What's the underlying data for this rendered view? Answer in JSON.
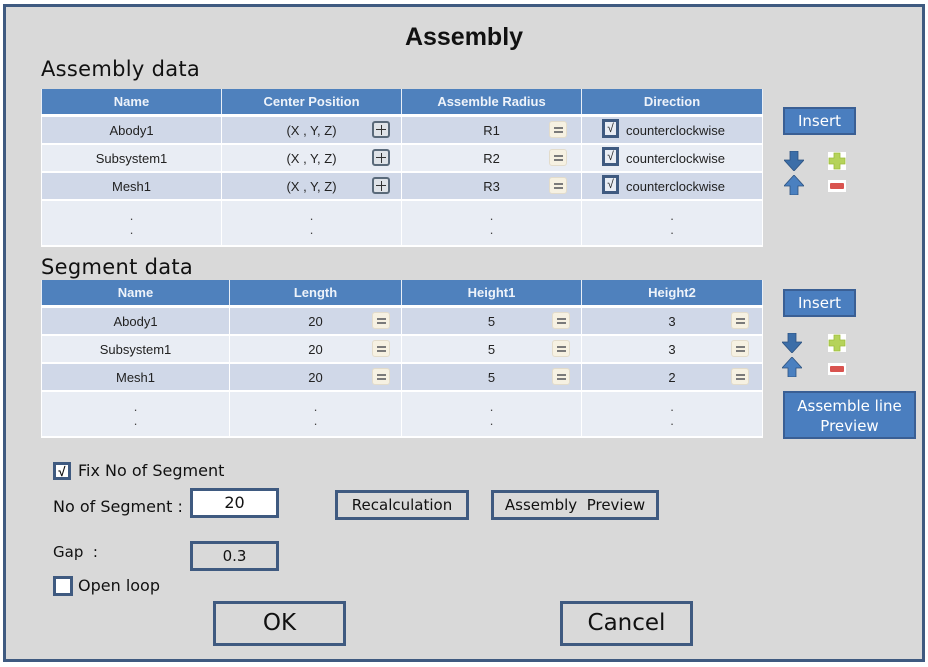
{
  "window": {
    "title": "Assembly"
  },
  "assembly": {
    "section_title": "Assembly data",
    "columns": [
      "Name",
      "Center Position",
      "Assemble Radius",
      "Direction"
    ],
    "rows": [
      {
        "name": "Abody1",
        "center": "(X , Y, Z)",
        "radius": "R1",
        "direction_checked": "√",
        "direction": "counterclockwise"
      },
      {
        "name": "Subsystem1",
        "center": "(X , Y, Z)",
        "radius": "R2",
        "direction_checked": "√",
        "direction": "counterclockwise"
      },
      {
        "name": "Mesh1",
        "center": "(X , Y, Z)",
        "radius": "R3",
        "direction_checked": "√",
        "direction": "counterclockwise"
      }
    ],
    "ellipsis": ".\n.",
    "insert_label": "Insert",
    "icons": {
      "move_down": "arrow-down-icon",
      "move_up": "arrow-up-icon",
      "add": "plus-icon",
      "remove": "minus-icon"
    }
  },
  "segment": {
    "section_title": "Segment data",
    "columns": [
      "Name",
      "Length",
      "Height1",
      "Height2"
    ],
    "rows": [
      {
        "name": "Abody1",
        "length": "20",
        "height1": "5",
        "height2": "3"
      },
      {
        "name": "Subsystem1",
        "length": "20",
        "height1": "5",
        "height2": "3"
      },
      {
        "name": "Mesh1",
        "length": "20",
        "height1": "5",
        "height2": "2"
      }
    ],
    "insert_label": "Insert",
    "preview_line1": "Assemble line",
    "preview_line2": "Preview"
  },
  "options": {
    "fix_segment_label": "Fix No of Segment",
    "fix_segment_mark": "√",
    "no_segment_label": "No of Segment :",
    "no_segment_value": "20",
    "recalc_label": "Recalculation",
    "assembly_preview_label": "Assembly  Preview",
    "gap_label": "Gap  :",
    "gap_value": "0.3",
    "open_loop_label": "Open loop"
  },
  "footer": {
    "ok_label": "OK",
    "cancel_label": "Cancel"
  },
  "colors": {
    "header_blue": "#4f81bd",
    "border_navy": "#3f5a80",
    "background": "#d9d9d9"
  }
}
